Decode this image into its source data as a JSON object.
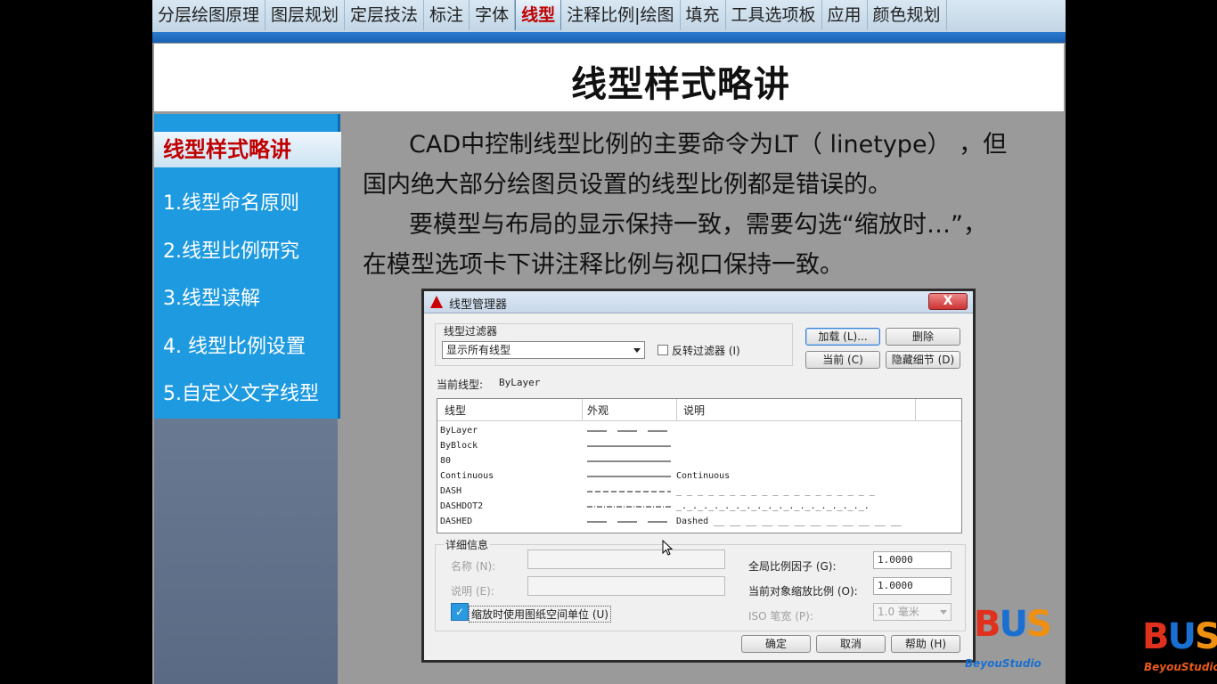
{
  "tabs": [
    {
      "label": "分层绘图原理",
      "active": false
    },
    {
      "label": "图层规划",
      "active": false
    },
    {
      "label": "定层技法",
      "active": false
    },
    {
      "label": "标注",
      "active": false
    },
    {
      "label": "字体",
      "active": false
    },
    {
      "label": "线型",
      "active": true
    },
    {
      "label": "注释比例|绘图",
      "active": false
    },
    {
      "label": "填充",
      "active": false
    },
    {
      "label": "工具选项板",
      "active": false
    },
    {
      "label": "应用",
      "active": false
    },
    {
      "label": "颜色规划",
      "active": false
    }
  ],
  "page_title": "线型样式略讲",
  "sidebar": {
    "heading": "线型样式略讲",
    "items": [
      "1.线型命名原则",
      "2.线型比例研究",
      "3.线型读解",
      "4. 线型比例设置",
      "5.自定义文字线型"
    ]
  },
  "main": {
    "p1a": "CAD中控制线型比例的主要命令为LT（ linetype） ，但",
    "p1b": "国内绝大部分绘图员设置的线型比例都是错误的。",
    "p2a": "要模型与布局的显示保持一致，需要勾选“缩放时…”，",
    "p2b": "在模型选项卡下讲注释比例与视口保持一致。"
  },
  "dialog": {
    "title": "线型管理器",
    "close": "X",
    "filter_group": "线型过滤器",
    "filter_value": "显示所有线型",
    "invert_filter": "反转过滤器 (I)",
    "load_button": "加载 (L)...",
    "delete_button": "删除",
    "current_button": "当前 (C)",
    "hide_details_button": "隐藏细节 (D)",
    "current_linetype_label": "当前线型:",
    "current_linetype_value": "ByLayer",
    "columns": [
      "线型",
      "外观",
      "说明"
    ],
    "rows": [
      {
        "name": "ByLayer",
        "pattern": "dash-long",
        "desc": ""
      },
      {
        "name": "ByBlock",
        "pattern": "solid",
        "desc": ""
      },
      {
        "name": "80",
        "pattern": "solid",
        "desc": ""
      },
      {
        "name": "Continuous",
        "pattern": "solid",
        "desc": "Continuous"
      },
      {
        "name": "DASH",
        "pattern": "dash",
        "desc": "_ _ _ _ _ _ _ _ _ _ _ _ _ _ _ _ _ _ _"
      },
      {
        "name": "DASHDOT2",
        "pattern": "dashdot",
        "desc": "_._._._._._._._._._._._._._._._._._."
      },
      {
        "name": "DASHED",
        "pattern": "dash-long",
        "desc": "Dashed __ __ __ __ __ __ __ __ __ __ __ __"
      }
    ],
    "details_group": "详细信息",
    "name_label": "名称 (N):",
    "desc_label": "说明 (E):",
    "global_scale_label": "全局比例因子 (G):",
    "global_scale_value": "1.0000",
    "current_scale_label": "当前对象缩放比例 (O):",
    "current_scale_value": "1.0000",
    "paper_units_label": "缩放时使用图纸空间单位 (U)",
    "paper_units_checked": true,
    "iso_pen_label": "ISO 笔宽 (P):",
    "iso_pen_value": "1.0 毫米",
    "ok_button": "确定",
    "cancel_button": "取消",
    "help_button": "帮助 (H)"
  },
  "logos": {
    "big_text": "BUS",
    "small_text": "BeyouStudio"
  }
}
